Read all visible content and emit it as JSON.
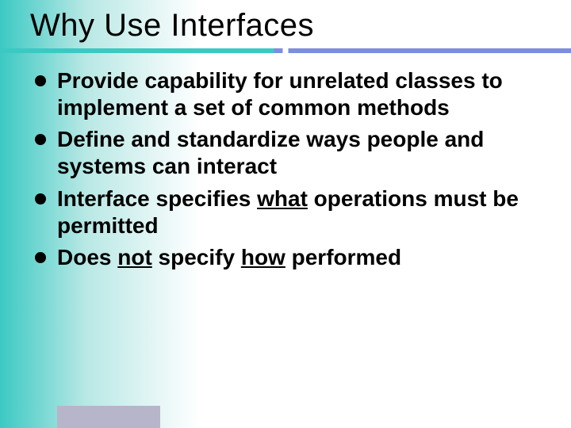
{
  "title": "Why Use Interfaces",
  "bullets": {
    "b0": {
      "text": "Provide capability for unrelated classes to implement a set of common methods"
    },
    "b1": {
      "text": "Define and standardize ways people and systems can interact"
    },
    "b2": {
      "pre": "Interface specifies ",
      "u1": "what",
      "post": " operations must be permitted"
    },
    "b3": {
      "pre": "Does ",
      "u1": "not",
      "mid": " specify ",
      "u2": "how",
      "post": " performed"
    }
  }
}
